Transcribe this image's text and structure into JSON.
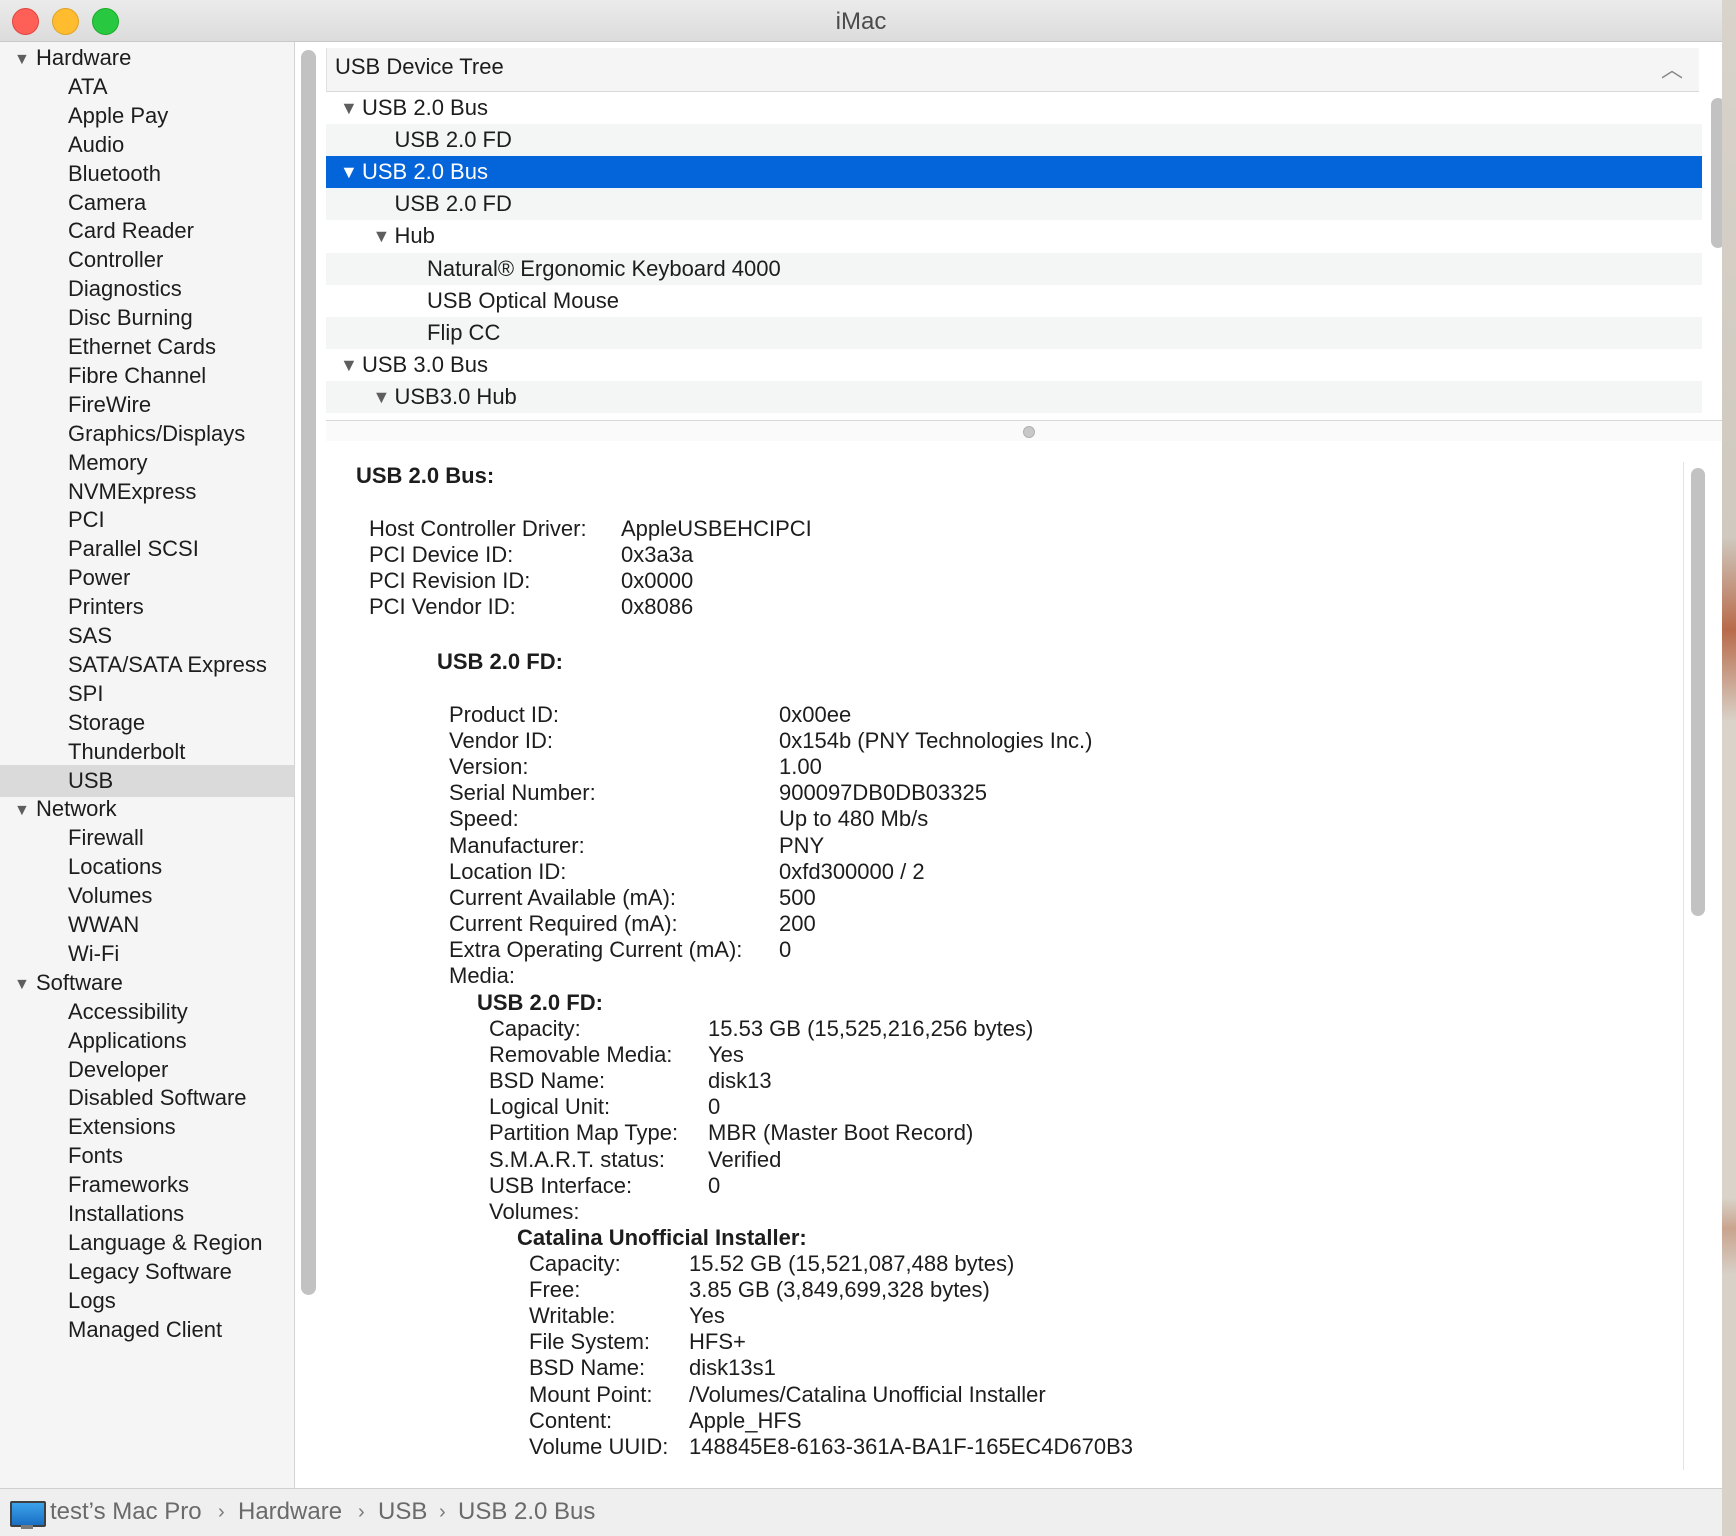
{
  "window": {
    "title": "iMac"
  },
  "sidebar": {
    "groups": [
      {
        "label": "Hardware",
        "items": [
          "ATA",
          "Apple Pay",
          "Audio",
          "Bluetooth",
          "Camera",
          "Card Reader",
          "Controller",
          "Diagnostics",
          "Disc Burning",
          "Ethernet Cards",
          "Fibre Channel",
          "FireWire",
          "Graphics/Displays",
          "Memory",
          "NVMExpress",
          "PCI",
          "Parallel SCSI",
          "Power",
          "Printers",
          "SAS",
          "SATA/SATA Express",
          "SPI",
          "Storage",
          "Thunderbolt",
          "USB"
        ]
      },
      {
        "label": "Network",
        "items": [
          "Firewall",
          "Locations",
          "Volumes",
          "WWAN",
          "Wi-Fi"
        ]
      },
      {
        "label": "Software",
        "items": [
          "Accessibility",
          "Applications",
          "Developer",
          "Disabled Software",
          "Extensions",
          "Fonts",
          "Frameworks",
          "Installations",
          "Language & Region",
          "Legacy Software",
          "Logs",
          "Managed Client"
        ]
      }
    ],
    "selected": "USB"
  },
  "tree": {
    "header": "USB Device Tree",
    "rows": [
      {
        "label": "USB 2.0 Bus",
        "level": 0,
        "expanded": true
      },
      {
        "label": "USB 2.0 FD",
        "level": 1
      },
      {
        "label": "USB 2.0 Bus",
        "level": 0,
        "expanded": true,
        "selected": true
      },
      {
        "label": "USB 2.0 FD",
        "level": 1
      },
      {
        "label": "Hub",
        "level": 1,
        "expanded": true
      },
      {
        "label": "Natural® Ergonomic Keyboard 4000",
        "level": 2
      },
      {
        "label": "USB Optical Mouse",
        "level": 2
      },
      {
        "label": "Flip CC",
        "level": 2
      },
      {
        "label": "USB 3.0 Bus",
        "level": 0,
        "expanded": true
      },
      {
        "label": "USB3.0 Hub",
        "level": 1,
        "expanded": true
      }
    ]
  },
  "detail": {
    "title": "USB 2.0 Bus:",
    "bus_props": [
      {
        "k": "Host Controller Driver:",
        "v": "AppleUSBEHCIPCI"
      },
      {
        "k": "PCI Device ID:",
        "v": "0x3a3a"
      },
      {
        "k": "PCI Revision ID:",
        "v": "0x0000"
      },
      {
        "k": "PCI Vendor ID:",
        "v": "0x8086"
      }
    ],
    "device_title": "USB 2.0 FD:",
    "device_props": [
      {
        "k": "Product ID:",
        "v": "0x00ee"
      },
      {
        "k": "Vendor ID:",
        "v": "0x154b  (PNY Technologies Inc.)"
      },
      {
        "k": "Version:",
        "v": "1.00"
      },
      {
        "k": "Serial Number:",
        "v": "900097DB0DB03325"
      },
      {
        "k": "Speed:",
        "v": "Up to 480 Mb/s"
      },
      {
        "k": "Manufacturer:",
        "v": "PNY"
      },
      {
        "k": "Location ID:",
        "v": "0xfd300000 / 2"
      },
      {
        "k": "Current Available (mA):",
        "v": "500"
      },
      {
        "k": "Current Required (mA):",
        "v": "200"
      },
      {
        "k": "Extra Operating Current (mA):",
        "v": "0"
      },
      {
        "k": "Media:",
        "v": ""
      }
    ],
    "media_title": "USB 2.0 FD:",
    "media_props": [
      {
        "k": "Capacity:",
        "v": "15.53 GB (15,525,216,256 bytes)"
      },
      {
        "k": "Removable Media:",
        "v": "Yes"
      },
      {
        "k": "BSD Name:",
        "v": "disk13"
      },
      {
        "k": "Logical Unit:",
        "v": "0"
      },
      {
        "k": "Partition Map Type:",
        "v": "MBR (Master Boot Record)"
      },
      {
        "k": "S.M.A.R.T. status:",
        "v": "Verified"
      },
      {
        "k": "USB Interface:",
        "v": "0"
      },
      {
        "k": "Volumes:",
        "v": ""
      }
    ],
    "volume_title": "Catalina Unofficial Installer:",
    "volume_props": [
      {
        "k": "Capacity:",
        "v": "15.52 GB (15,521,087,488 bytes)"
      },
      {
        "k": "Free:",
        "v": "3.85 GB (3,849,699,328 bytes)"
      },
      {
        "k": "Writable:",
        "v": "Yes"
      },
      {
        "k": "File System:",
        "v": "HFS+"
      },
      {
        "k": "BSD Name:",
        "v": "disk13s1"
      },
      {
        "k": "Mount Point:",
        "v": "/Volumes/Catalina Unofficial Installer"
      },
      {
        "k": "Content:",
        "v": "Apple_HFS"
      },
      {
        "k": "Volume UUID:",
        "v": "148845E8-6163-361A-BA1F-165EC4D670B3"
      }
    ]
  },
  "pathbar": {
    "icon": "imac-icon",
    "crumbs": [
      "test’s Mac Pro",
      "Hardware",
      "USB",
      "USB 2.0 Bus"
    ],
    "separator": "›"
  }
}
